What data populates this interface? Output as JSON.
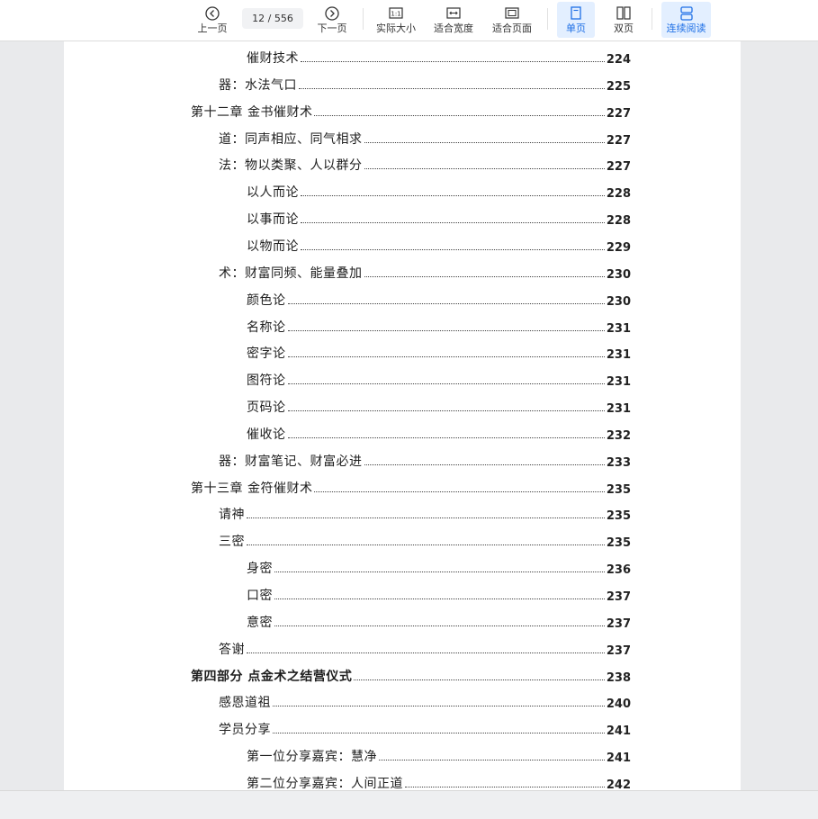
{
  "toolbar": {
    "prev_label": "上一页",
    "page_indicator": "12 / 556",
    "next_label": "下一页",
    "actual_size_label": "实际大小",
    "actual_size_icon_text": "1:1",
    "fit_width_label": "适合宽度",
    "fit_page_label": "适合页面",
    "single_page_label": "单页",
    "double_page_label": "双页",
    "continuous_label": "连续阅读",
    "active_color": "#1e6fe6"
  },
  "toc": [
    {
      "level": 2,
      "text": "催财技术",
      "page": "224"
    },
    {
      "level": 1,
      "text": "器：水法气口",
      "page": "225"
    },
    {
      "level": 0,
      "text": "第十二章 金书催财术",
      "page": "227"
    },
    {
      "level": 1,
      "text": "道：同声相应、同气相求",
      "page": "227"
    },
    {
      "level": 1,
      "text": "法：物以类聚、人以群分",
      "page": "227"
    },
    {
      "level": 2,
      "text": "以人而论",
      "page": "228"
    },
    {
      "level": 2,
      "text": "以事而论",
      "page": "228"
    },
    {
      "level": 2,
      "text": "以物而论",
      "page": "229"
    },
    {
      "level": 1,
      "text": "术：财富同频、能量叠加",
      "page": "230"
    },
    {
      "level": 2,
      "text": "颜色论",
      "page": "230"
    },
    {
      "level": 2,
      "text": "名称论",
      "page": "231"
    },
    {
      "level": 2,
      "text": "密字论",
      "page": "231"
    },
    {
      "level": 2,
      "text": "图符论",
      "page": "231"
    },
    {
      "level": 2,
      "text": "页码论",
      "page": "231"
    },
    {
      "level": 2,
      "text": "催收论",
      "page": "232"
    },
    {
      "level": 1,
      "text": "器：财富笔记、财富必进",
      "page": "233"
    },
    {
      "level": 0,
      "text": "第十三章 金符催财术",
      "page": "235"
    },
    {
      "level": 1,
      "text": "请神",
      "page": "235"
    },
    {
      "level": 1,
      "text": "三密",
      "page": "235"
    },
    {
      "level": 2,
      "text": "身密",
      "page": "236"
    },
    {
      "level": 2,
      "text": "口密",
      "page": "237"
    },
    {
      "level": 2,
      "text": "意密",
      "page": "237"
    },
    {
      "level": 1,
      "text": "答谢",
      "page": "237"
    },
    {
      "level": 0,
      "text": "第四部分 点金术之结营仪式",
      "page": "238",
      "bold": true
    },
    {
      "level": 1,
      "text": "感恩道祖",
      "page": "240"
    },
    {
      "level": 1,
      "text": "学员分享",
      "page": "241"
    },
    {
      "level": 2,
      "text": "第一位分享嘉宾：慧净",
      "page": "241"
    },
    {
      "level": 2,
      "text": "第二位分享嘉宾：人间正道",
      "page": "242"
    }
  ]
}
